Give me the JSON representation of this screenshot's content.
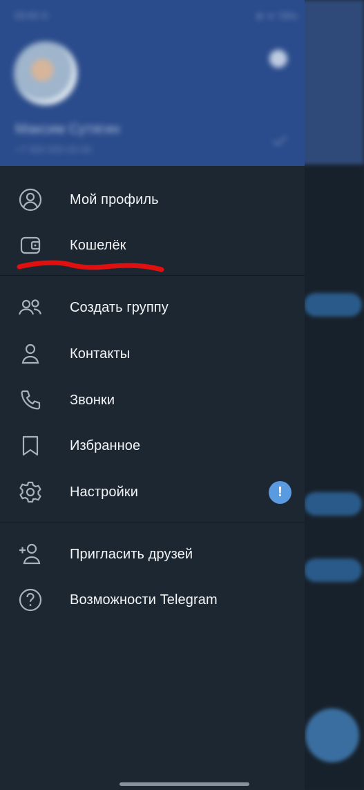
{
  "header": {
    "status_left": "18:43 ⊙",
    "status_right": "⊛ ᯤ 78%",
    "user_name": "Максим Сутягин",
    "user_phone": "+7 900 000-00-00"
  },
  "menu": {
    "group1": [
      {
        "label": "Мой профиль",
        "icon": "profile-icon"
      },
      {
        "label": "Кошелёк",
        "icon": "wallet-icon"
      }
    ],
    "group2": [
      {
        "label": "Создать группу",
        "icon": "group-icon"
      },
      {
        "label": "Контакты",
        "icon": "contact-icon"
      },
      {
        "label": "Звонки",
        "icon": "phone-icon"
      },
      {
        "label": "Избранное",
        "icon": "bookmark-icon"
      },
      {
        "label": "Настройки",
        "icon": "settings-icon",
        "badge": "!"
      }
    ],
    "group3": [
      {
        "label": "Пригласить друзей",
        "icon": "invite-icon"
      },
      {
        "label": "Возможности Telegram",
        "icon": "help-icon"
      }
    ]
  },
  "colors": {
    "drawer_bg": "#1d2731",
    "header_bg": "#2b4c8c",
    "accent": "#5a9ae0",
    "annotation": "#e01010"
  }
}
